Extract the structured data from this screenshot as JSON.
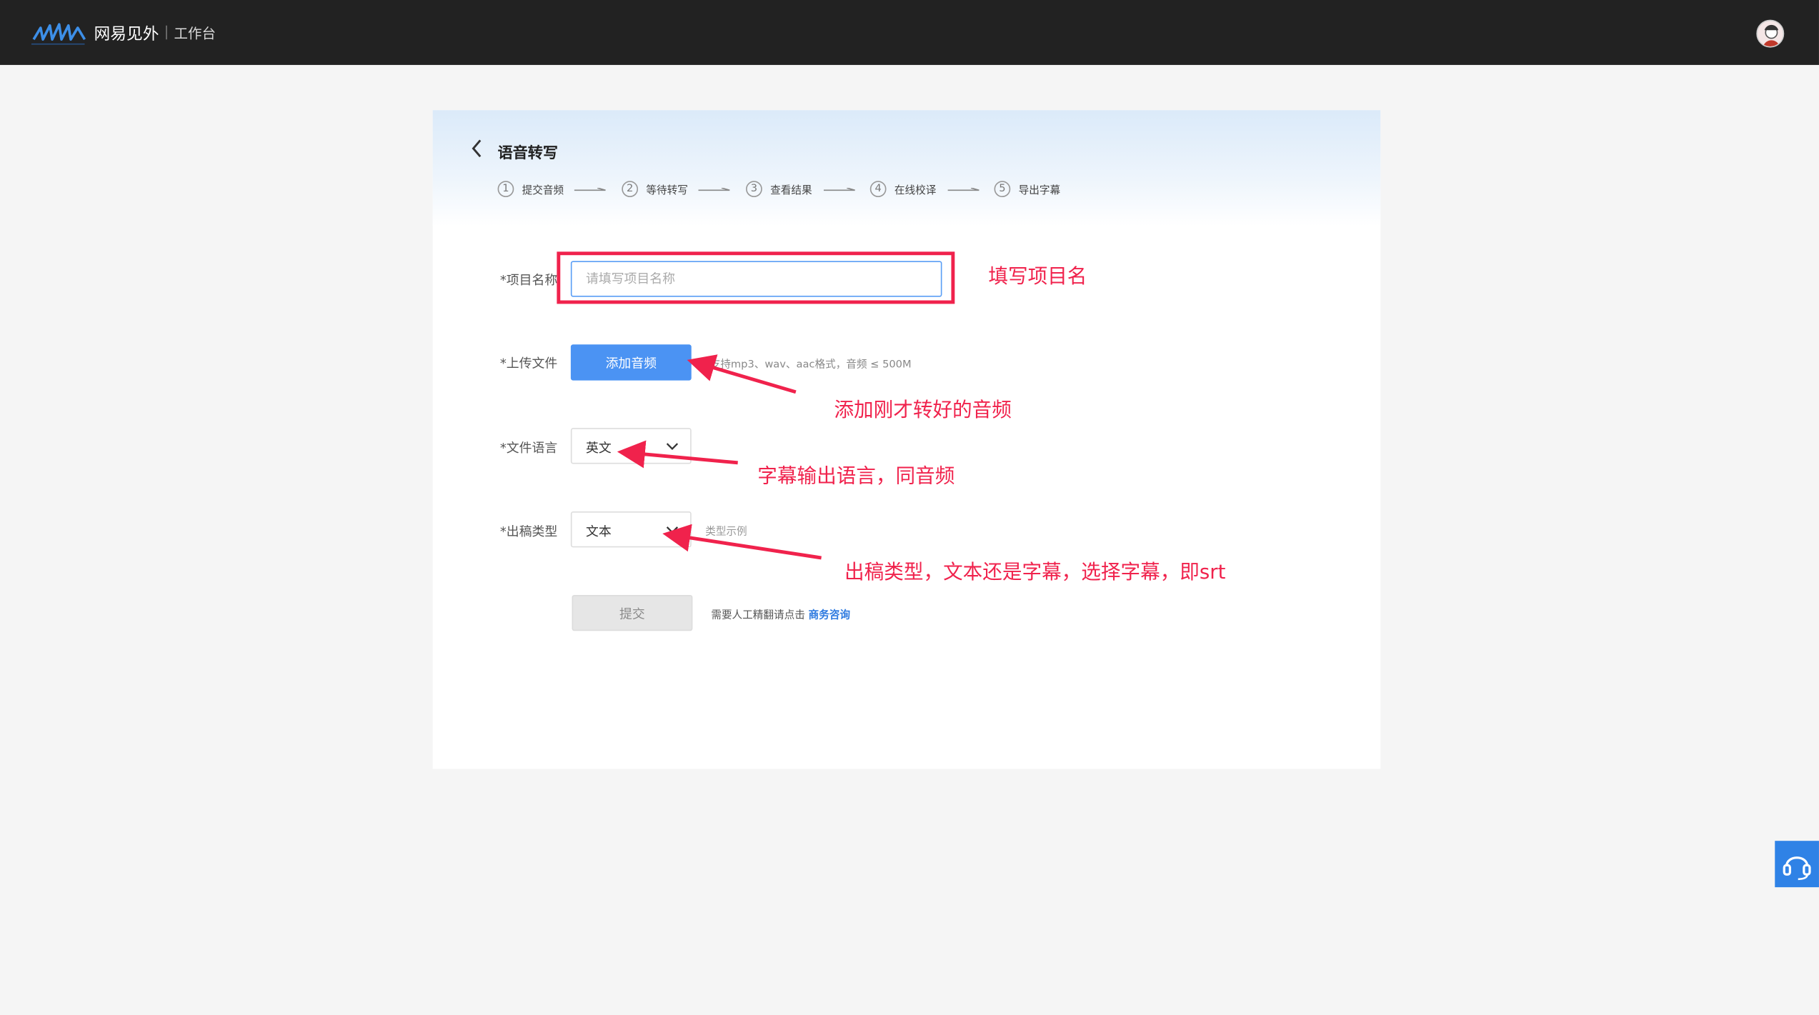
{
  "header": {
    "brand": "网易见外",
    "workspace": "工作台"
  },
  "page": {
    "title": "语音转写",
    "steps": [
      {
        "num": "1",
        "label": "提交音频"
      },
      {
        "num": "2",
        "label": "等待转写"
      },
      {
        "num": "3",
        "label": "查看结果"
      },
      {
        "num": "4",
        "label": "在线校译"
      },
      {
        "num": "5",
        "label": "导出字幕"
      }
    ]
  },
  "form": {
    "name_label": "*项目名称",
    "name_placeholder": "请填写项目名称",
    "upload_label": "*上传文件",
    "upload_button": "添加音频",
    "upload_hint": "支持mp3、wav、aac格式，音频 ≤ 500M",
    "language_label": "*文件语言",
    "language_value": "英文",
    "output_label": "*出稿类型",
    "output_value": "文本",
    "type_example": "类型示例",
    "submit": "提交",
    "consult_text": "需要人工精翻请点击",
    "consult_link": "商务咨询"
  },
  "annotations": {
    "name": "填写项目名",
    "upload": "添加刚才转好的音频",
    "language": "字幕输出语言，同音频",
    "output": "出稿类型，文本还是字幕，选择字幕，即srt"
  },
  "colors": {
    "topbar": "#222222",
    "accent": "#4b93f3",
    "annotation": "#f0224c"
  }
}
